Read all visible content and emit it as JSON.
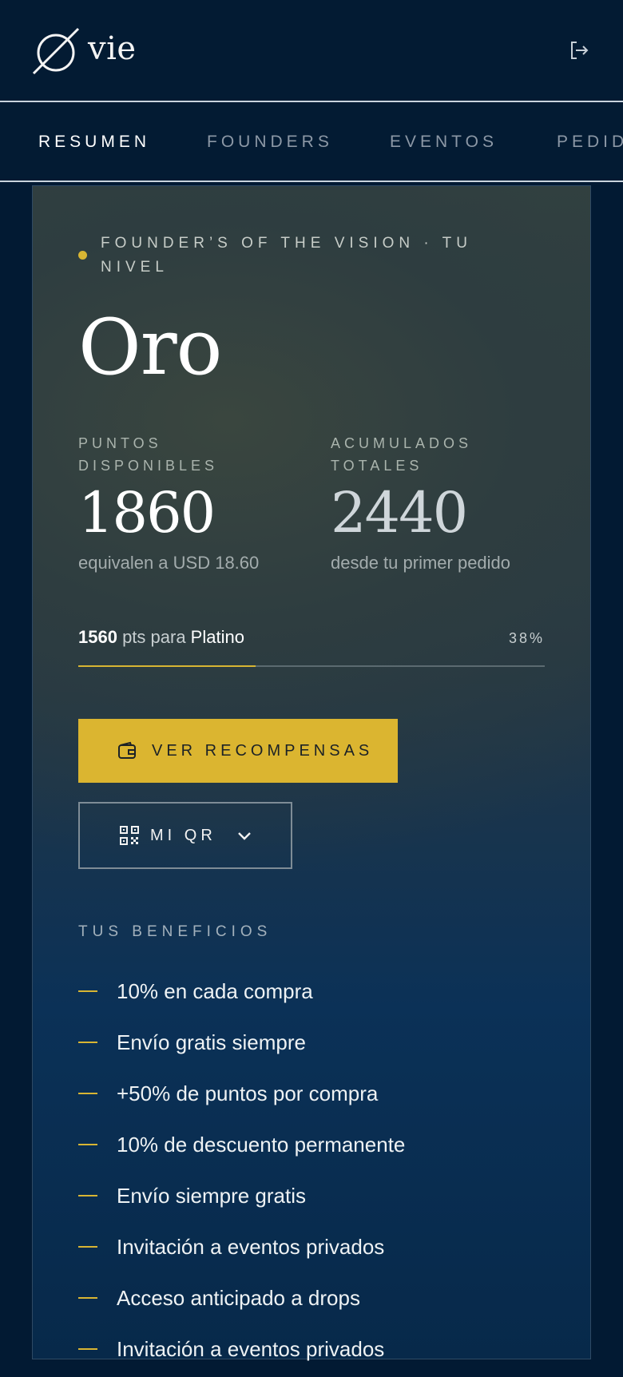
{
  "brand": {
    "name": "vie"
  },
  "tabs": [
    {
      "label": "RESUMEN"
    },
    {
      "label": "FOUNDERS"
    },
    {
      "label": "EVENTOS"
    },
    {
      "label": "PEDID"
    }
  ],
  "card": {
    "eyebrow": "FOUNDER’S OF THE VISION · TU NIVEL",
    "level": "Oro",
    "stats": {
      "available": {
        "label": "PUNTOS DISPONIBLES",
        "value": "1860",
        "sub": "equivalen a USD 18.60"
      },
      "total": {
        "label": "ACUMULADOS TOTALES",
        "value": "2440",
        "sub": "desde tu primer pedido"
      }
    },
    "progress": {
      "points": "1560",
      "text": " pts para ",
      "target": "Platino",
      "percent_label": "38%",
      "fraction": 0.38
    },
    "buttons": {
      "rewards": "VER RECOMPENSAS",
      "qr": "MI QR"
    },
    "benefits_title": "TUS BENEFICIOS",
    "benefits": [
      "10% en cada compra",
      "Envío gratis siempre",
      "+50% de puntos por compra",
      "10% de descuento permanente",
      "Envío siempre gratis",
      "Invitación a eventos privados",
      "Acceso anticipado a drops",
      "Invitación a eventos privados"
    ]
  },
  "colors": {
    "background": "#021a33",
    "accent": "#d8b533",
    "button": "#dbb530"
  },
  "icons": {
    "logout": "logout-icon",
    "wallet": "wallet-icon",
    "qr": "qr-code-icon",
    "chevron": "chevron-down-icon"
  }
}
